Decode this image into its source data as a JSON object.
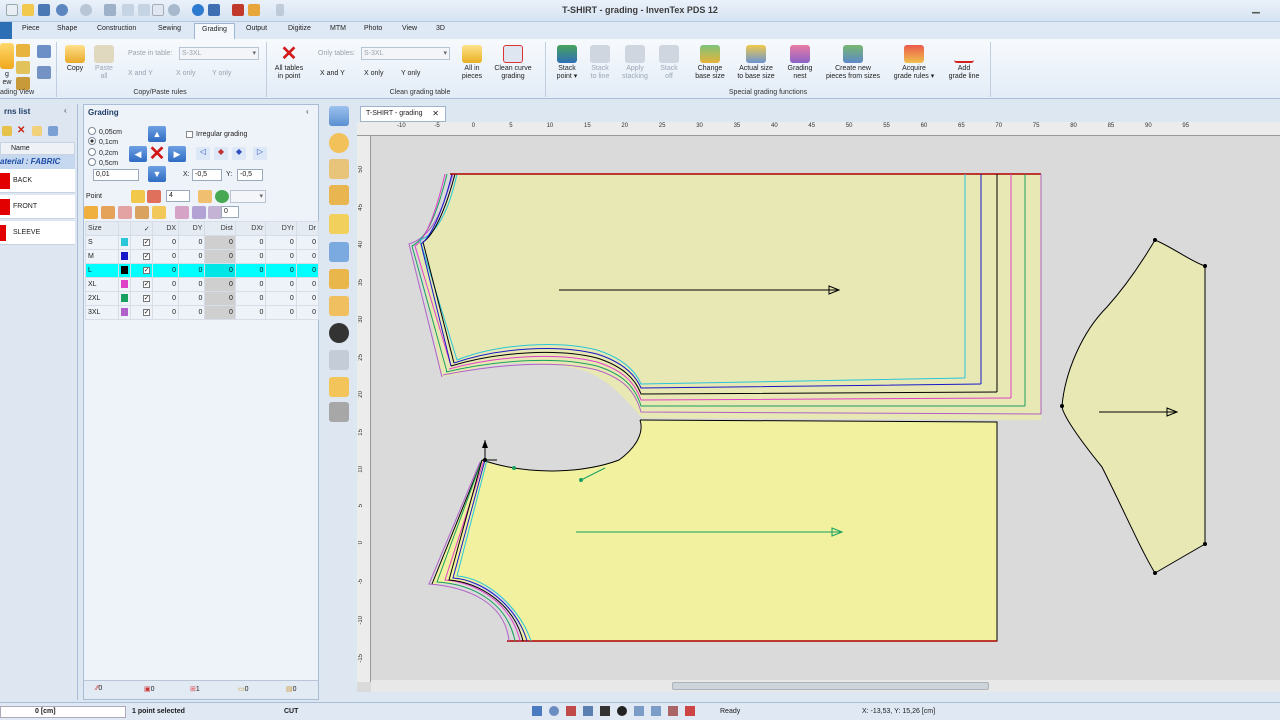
{
  "window": {
    "title": "T-SHIRT - grading - InvenTex PDS 12"
  },
  "tabs": [
    "Piece",
    "Shape",
    "Construction",
    "Sewing",
    "Grading",
    "Output",
    "Digitize",
    "MTM",
    "Photo",
    "View",
    "3D"
  ],
  "ribbon": {
    "copy_paste": {
      "left_labels": [
        "g",
        "ew"
      ],
      "copy": "Copy",
      "paste_all": [
        "Paste",
        "all"
      ],
      "paste_in_table_label": "Paste in table:",
      "paste_in_table_value": "S-3XL",
      "x_and_y": "X and Y",
      "x_only": "X only",
      "y_only": "Y only",
      "group_left": "ading View",
      "group": "Copy/Paste rules"
    },
    "clean_table": {
      "all_tables": [
        "All tables",
        "in point"
      ],
      "only_tables_label": "Only tables:",
      "only_tables_value": "S-3XL",
      "x_and_y": "X and Y",
      "x_only": "X only",
      "y_only": "Y only",
      "group": "Clean grading table"
    },
    "all_in_pieces": [
      "All in",
      "pieces"
    ],
    "clean_curve": [
      "Clean curve",
      "grading"
    ],
    "stack_point": [
      "Stack",
      "point ▾"
    ],
    "stack_to_line": [
      "Stack",
      "to line"
    ],
    "apply_stacking": [
      "Apply",
      "stacking"
    ],
    "stack_off": [
      "Stack",
      "off"
    ],
    "change_base": [
      "Change",
      "base size"
    ],
    "actual_size": [
      "Actual size",
      "to base size"
    ],
    "grading_nest": [
      "Grading",
      "nest"
    ],
    "create_new_pieces": [
      "Create new",
      "pieces from sizes"
    ],
    "acquire_rules": [
      "Acquire",
      "grade rules ▾"
    ],
    "add_grade_line": [
      "Add",
      "grade line"
    ],
    "special_group": "Special grading functions"
  },
  "patterns_panel": {
    "title": "rns list",
    "name_header": "Name",
    "material": "aterial : FABRIC",
    "patterns": [
      "BACK",
      "FRONT",
      "SLEEVE"
    ]
  },
  "grading_panel": {
    "title": "Grading",
    "steps": [
      "0,05cm",
      "0,1cm",
      "0,2cm",
      "0,5cm"
    ],
    "selected_step": "0,1cm",
    "custom_step": "0,01",
    "irregular": "Irregular grading",
    "x_label": "X:",
    "x_value": "-0,5",
    "y_label": "Y:",
    "y_value": "-0,5",
    "point_label": "Point",
    "point_value": "4",
    "extra_value": "0",
    "headers": [
      "Size",
      "✓",
      "DX",
      "DY",
      "Dist",
      "DXr",
      "DYr",
      "Dr"
    ],
    "rows": [
      {
        "size": "S",
        "color": "#29c6d9",
        "vals": [
          "0",
          "0",
          "0",
          "0",
          "0",
          "0"
        ]
      },
      {
        "size": "M",
        "color": "#1818c8",
        "vals": [
          "0",
          "0",
          "0",
          "0",
          "0",
          "0"
        ]
      },
      {
        "size": "L",
        "color": "#000000",
        "vals": [
          "0",
          "0",
          "0",
          "0",
          "0",
          "0"
        ]
      },
      {
        "size": "XL",
        "color": "#e040c8",
        "vals": [
          "0",
          "0",
          "0",
          "0",
          "0",
          "0"
        ]
      },
      {
        "size": "2XL",
        "color": "#18a060",
        "vals": [
          "0",
          "0",
          "0",
          "0",
          "0",
          "0"
        ]
      },
      {
        "size": "3XL",
        "color": "#b060c8",
        "vals": [
          "0",
          "0",
          "0",
          "0",
          "0",
          "0"
        ]
      }
    ],
    "footer": [
      "0",
      "0",
      "1",
      "0",
      "0"
    ]
  },
  "doc_tab": "T-SHIRT - grading",
  "ruler_top_ticks": [
    "-10",
    "-5",
    "0",
    "5",
    "10",
    "15",
    "20",
    "25",
    "30",
    "35",
    "40",
    "45",
    "50",
    "55",
    "60",
    "65",
    "70",
    "75",
    "80",
    "85",
    "90",
    "95"
  ],
  "ruler_left_ticks": [
    "50",
    "45",
    "40",
    "35",
    "30",
    "25",
    "20",
    "15",
    "10",
    "5",
    "0",
    "-5",
    "-10",
    "-15"
  ],
  "status": {
    "value": "0 [cm]",
    "selection": "1 point selected",
    "mode": "CUT",
    "ready": "Ready",
    "coords": "X: -13,53, Y: 15,26 [cm]"
  },
  "colors": {
    "cyan": "#29c6d9",
    "blue": "#1818c8",
    "black": "#000000",
    "magenta": "#e040c8",
    "green": "#18a060",
    "purple": "#b060c8",
    "piece_fill": "#e8e8b4",
    "front_fill": "#f1f1a0",
    "seam_red": "#b00000"
  }
}
